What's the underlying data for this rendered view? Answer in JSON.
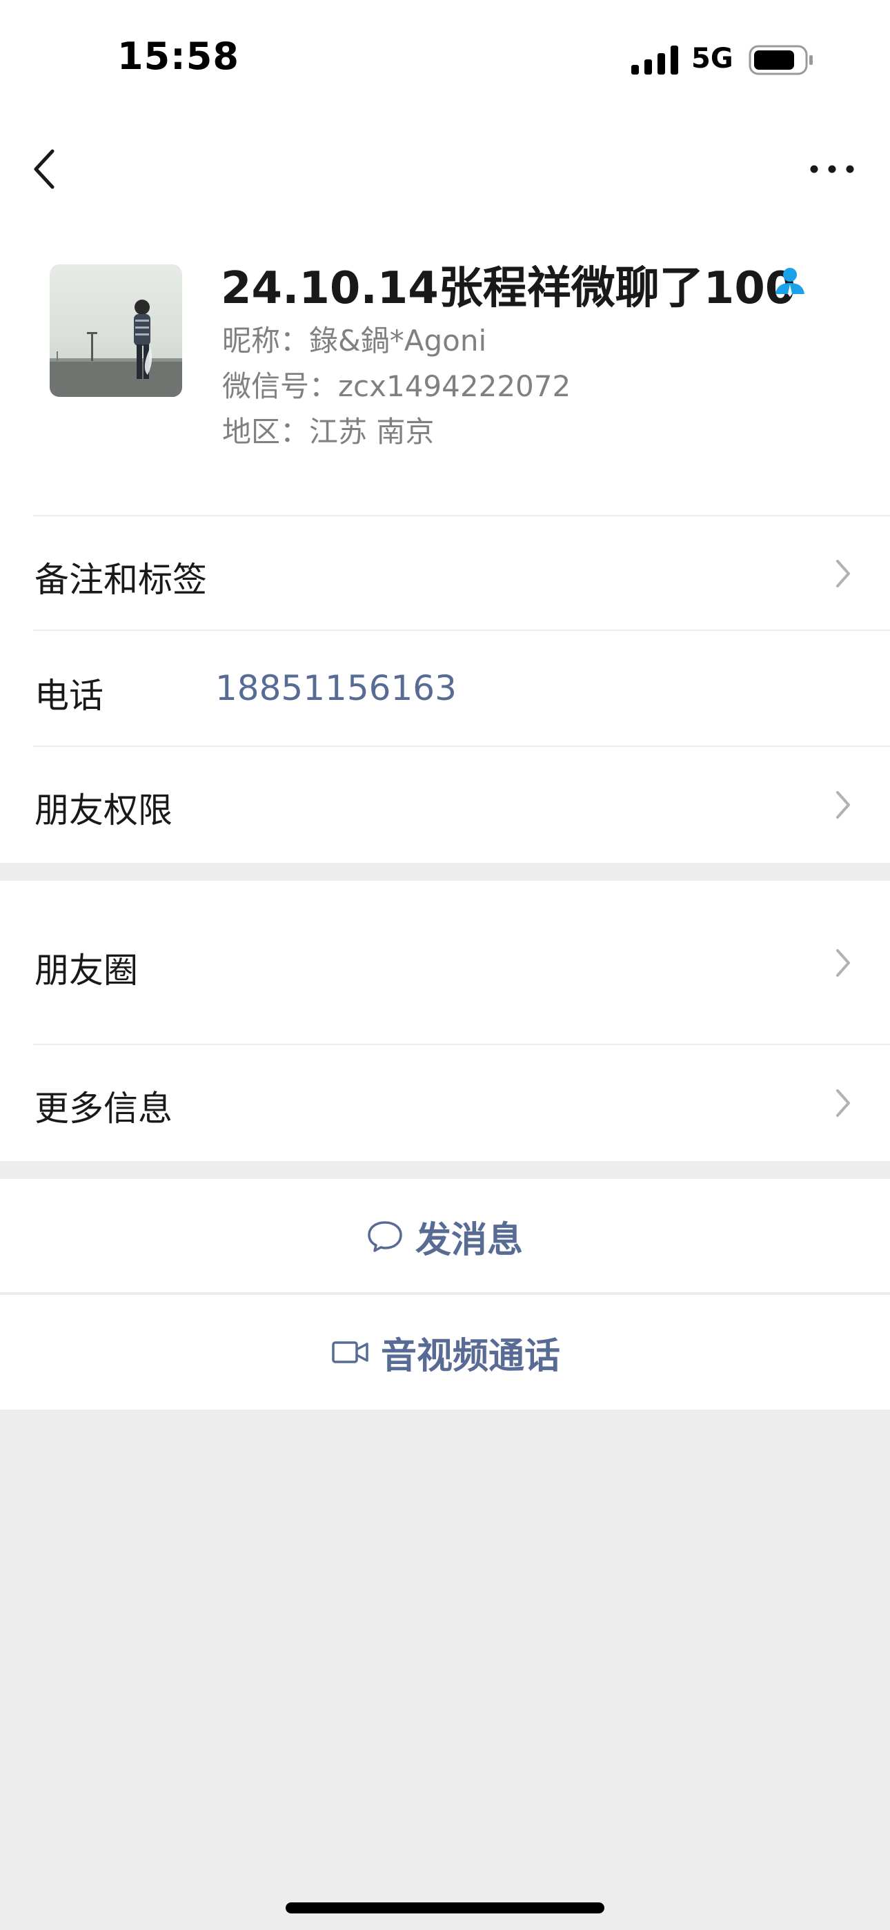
{
  "status_bar": {
    "time": "15:58",
    "network": "5G"
  },
  "nav": {
    "back_icon": "chevron-left-icon",
    "more_icon": "ellipsis-icon"
  },
  "profile": {
    "name": "24.10.14张程祥微聊了100",
    "nickname": "昵称：錄&鍋*Agoni",
    "wechat_id": "微信号：zcx1494222072",
    "region": "地区：江苏 南京",
    "badge_icon": "contact-person-icon",
    "badge_color": "#1aa2e8"
  },
  "rows": {
    "remark_tags": "备注和标签",
    "phone_label": "电话",
    "phone_value": "18851156163",
    "permissions": "朋友权限",
    "moments": "朋友圈",
    "more_info": "更多信息"
  },
  "actions": {
    "message": "发消息",
    "call": "音视频通话"
  },
  "colors": {
    "link": "#576b95",
    "text": "#191919",
    "secondary": "#808080",
    "background": "#ededed"
  }
}
